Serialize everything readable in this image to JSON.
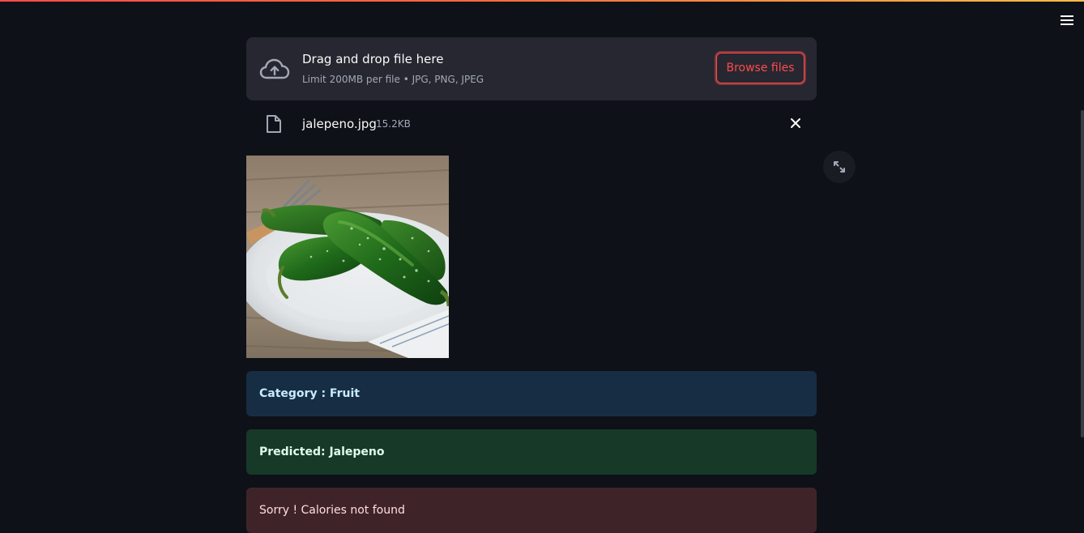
{
  "uploader": {
    "title": "Drag and drop file here",
    "limit": "Limit 200MB per file • JPG, PNG, JPEG",
    "browse_label": "Browse files"
  },
  "file": {
    "name": "jalepeno.jpg",
    "size": "15.2KB"
  },
  "alerts": {
    "category": "Category : Fruit",
    "predicted": "Predicted: Jalepeno",
    "calories": "Sorry ! Calories not found"
  },
  "colors": {
    "accent": "#ff4b4b",
    "background": "#0e1117",
    "info_bg": "#172d43",
    "success_bg": "#173928",
    "error_bg": "#3e2428"
  },
  "icons": [
    "hamburger-menu-icon",
    "cloud-upload-icon",
    "file-icon",
    "close-icon",
    "fullscreen-icon"
  ]
}
